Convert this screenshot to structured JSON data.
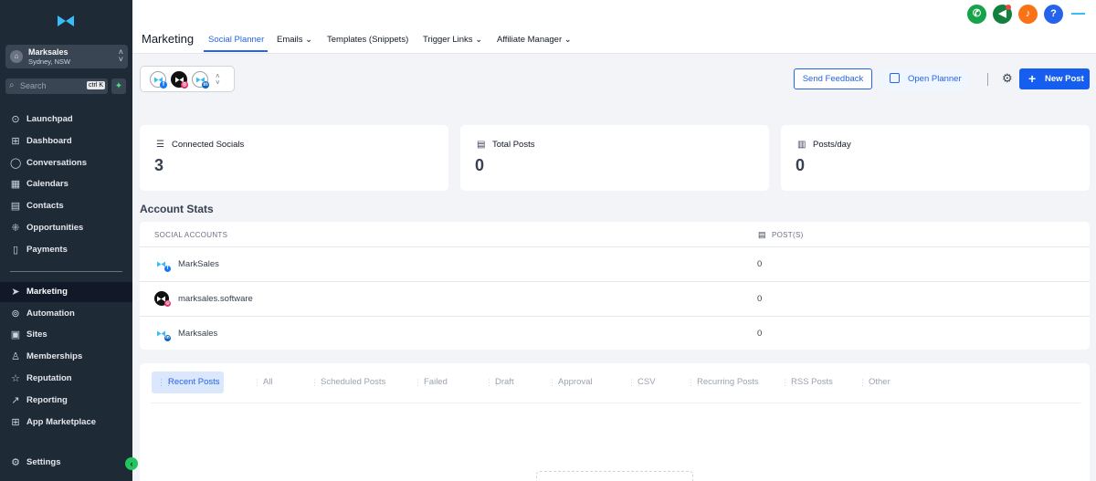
{
  "sidebar": {
    "account": {
      "name": "Marksales",
      "location": "Sydney, NSW"
    },
    "search": {
      "placeholder": "Search",
      "shortcut": "ctrl K"
    },
    "items_top": [
      {
        "label": "Launchpad",
        "icon": "rocket-icon"
      },
      {
        "label": "Dashboard",
        "icon": "grid-icon"
      },
      {
        "label": "Conversations",
        "icon": "chat-icon"
      },
      {
        "label": "Calendars",
        "icon": "calendar-icon"
      },
      {
        "label": "Contacts",
        "icon": "contact-card-icon"
      },
      {
        "label": "Opportunities",
        "icon": "network-icon"
      },
      {
        "label": "Payments",
        "icon": "receipt-icon"
      }
    ],
    "items_bottom": [
      {
        "label": "Marketing",
        "icon": "send-icon",
        "active": true
      },
      {
        "label": "Automation",
        "icon": "automation-icon"
      },
      {
        "label": "Sites",
        "icon": "sites-icon"
      },
      {
        "label": "Memberships",
        "icon": "membership-icon"
      },
      {
        "label": "Reputation",
        "icon": "star-icon"
      },
      {
        "label": "Reporting",
        "icon": "trend-icon"
      },
      {
        "label": "App Marketplace",
        "icon": "apps-icon"
      }
    ],
    "settings": {
      "label": "Settings",
      "icon": "gear-icon"
    }
  },
  "header": {
    "title": "Marketing",
    "tabs": [
      {
        "label": "Social Planner",
        "active": true
      },
      {
        "label": "Emails",
        "has_dropdown": true
      },
      {
        "label": "Templates (Snippets)"
      },
      {
        "label": "Trigger Links",
        "has_dropdown": true
      },
      {
        "label": "Affiliate Manager",
        "has_dropdown": true
      }
    ]
  },
  "actions": {
    "send_feedback": "Send Feedback",
    "open_planner": "Open Planner",
    "new_post": "New Post"
  },
  "stats": [
    {
      "label": "Connected Socials",
      "value": "3",
      "icon": "database-icon"
    },
    {
      "label": "Total Posts",
      "value": "0",
      "icon": "server-icon"
    },
    {
      "label": "Posts/day",
      "value": "0",
      "icon": "layout-icon"
    }
  ],
  "account_stats": {
    "title": "Account Stats",
    "columns": [
      "SOCIAL ACCOUNTS",
      "POST(S)"
    ],
    "rows": [
      {
        "name": "MarkSales",
        "posts": "0",
        "network": "facebook"
      },
      {
        "name": "marksales.software",
        "posts": "0",
        "network": "instagram"
      },
      {
        "name": "Marksales",
        "posts": "0",
        "network": "linkedin"
      }
    ]
  },
  "post_tabs": [
    {
      "label": "Recent Posts",
      "active": true
    },
    {
      "label": "All"
    },
    {
      "label": "Scheduled Posts"
    },
    {
      "label": "Failed"
    },
    {
      "label": "Draft"
    },
    {
      "label": "Approval"
    },
    {
      "label": "CSV"
    },
    {
      "label": "Recurring Posts"
    },
    {
      "label": "RSS Posts"
    },
    {
      "label": "Other"
    }
  ],
  "colors": {
    "sidebar_bg": "#1f2a37",
    "accent": "#2563eb",
    "primary_button": "#155eef",
    "facebook": "#1877f2",
    "instagram": "#e1306c",
    "linkedin": "#0a66c2"
  }
}
